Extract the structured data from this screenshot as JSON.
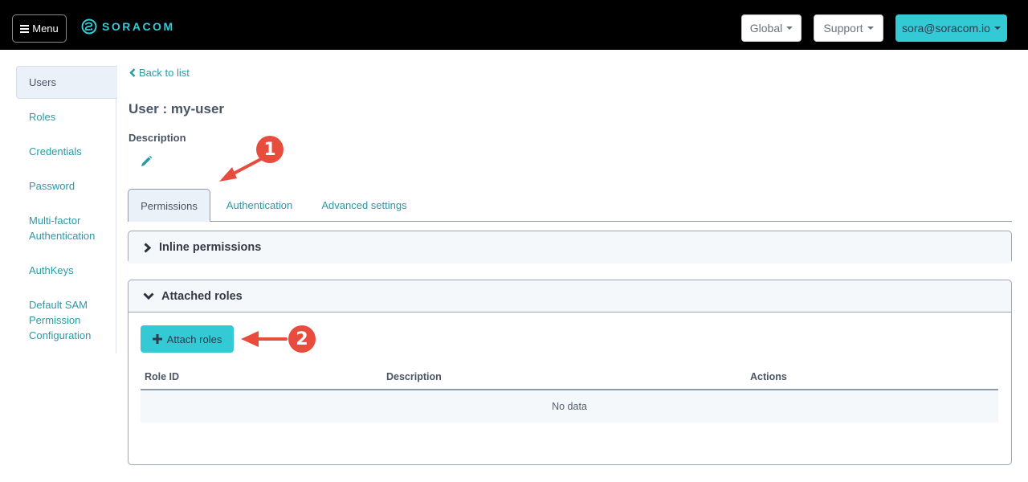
{
  "topbar": {
    "menu_label": "Menu",
    "brand": "SORACOM",
    "brand_color": "#33cad6",
    "region_label": "Global",
    "support_label": "Support",
    "account_label": "sora@soracom.io"
  },
  "sidebar": {
    "items": [
      {
        "label": "Users",
        "active": true
      },
      {
        "label": "Roles"
      },
      {
        "label": "Credentials"
      },
      {
        "label": "Password"
      },
      {
        "label": "Multi-factor Authentication"
      },
      {
        "label": "AuthKeys"
      },
      {
        "label": "Default SAM Permission Configuration"
      }
    ]
  },
  "main": {
    "back_label": "Back to list",
    "title": "User : my-user",
    "description_label": "Description",
    "tabs": [
      {
        "label": "Permissions",
        "active": true
      },
      {
        "label": "Authentication"
      },
      {
        "label": "Advanced settings"
      }
    ],
    "inline_permissions": {
      "title": "Inline permissions",
      "expanded": false
    },
    "attached_roles": {
      "title": "Attached roles",
      "expanded": true,
      "attach_label": "Attach roles",
      "columns": [
        "Role ID",
        "Description",
        "Actions"
      ],
      "rows": [],
      "empty_text": "No data"
    }
  },
  "annotations": [
    {
      "number": "1",
      "target": "Permissions tab"
    },
    {
      "number": "2",
      "target": "Attach roles button"
    }
  ],
  "colors": {
    "accent": "#33cad6",
    "link": "#2a9aa6",
    "annotation": "#e74c3c"
  }
}
